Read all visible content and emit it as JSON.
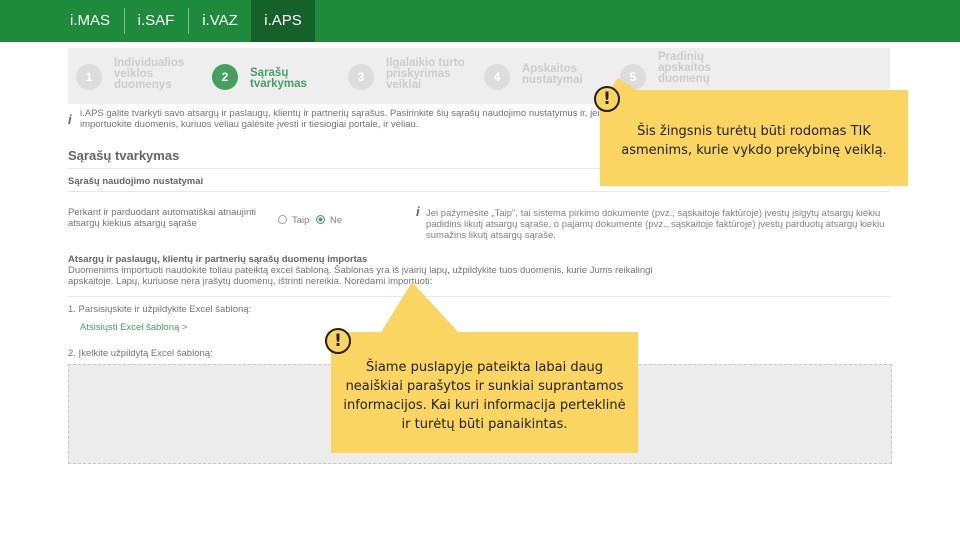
{
  "nav": {
    "tabs": [
      {
        "label": "i.MAS",
        "active": false
      },
      {
        "label": "i.SAF",
        "active": false
      },
      {
        "label": "i.VAZ",
        "active": false
      },
      {
        "label": "i.APS",
        "active": true
      }
    ]
  },
  "stepper": {
    "steps": [
      {
        "num": "1",
        "label": "Individualios veiklos duomenys",
        "active": false
      },
      {
        "num": "2",
        "label": "Sąrašų tvarkymas",
        "active": true
      },
      {
        "num": "3",
        "label": "Ilgalaikio turto priskyrimas veiklai",
        "active": false
      },
      {
        "num": "4",
        "label": "Apskaitos nustatymai",
        "active": false
      },
      {
        "num": "5",
        "label": "Pradinių apskaitos duomenų",
        "active": false
      }
    ]
  },
  "info_top": "i.APS galite tvarkyti savo atsargų ir paslaugų, klientų ir partnerių sąrašus. Pasirinkite šių sąrašų naudojimo nustatymus ir, jei norite, importuokite duomenis, kuriuos vėliau galėsite įvesti ir tiesiogiai portale, ir vėliau.",
  "section_title": "Sąrašų tvarkymas",
  "subsection_title": "Sąrašų naudojimo nustatymai",
  "auto_update_label": "Perkant ir parduodant automatiškai atnaujinti atsargų kiekius atsargų sąraše",
  "radio": {
    "yes": "Taip",
    "no": "Ne",
    "selected": "Ne"
  },
  "info_right": "Jei pažymėsite „Taip\", tai sistema pirkimo dokumente (pvz., sąskaitoje faktūroje) įvestų įsigytų atsargų kiekiu padidins likutį atsargų sąraše, o pajamų dokumente (pvz., sąskaitoje faktūroje) įvestų parduotų atsargų kiekiu sumažins likutį atsargų sąraše.",
  "import": {
    "heading": "Atsargų ir paslaugų, klientų ir partnerių sąrašų duomenų importas",
    "text": "Duomenims importuoti naudokite toliau pateiktą excel šabloną. Šablonas yra iš įvairių lapų, užpildykite tuos duomenis, kurie Jums reikalingi apskaitoje. Lapų, kuriuose nėra įrašytų duomenų, ištrinti nereikia. Norėdami importuoti:",
    "step1": "1. Parsisiųskite ir užpildykite Excel šabloną:",
    "download_link": "Atsisiųsti Excel šabloną  >",
    "step2": "2. Įkelkite užpildytą Excel šabloną:"
  },
  "callouts": {
    "warn_symbol": "!",
    "note1": "Šis žingsnis turėtų būti rodomas TIK asmenims, kurie vykdo prekybinę veiklą.",
    "note2": "Šiame puslapyje pateikta labai daug neaiškiai parašytos ir sunkiai suprantamos informacijos. Kai kuri informacija perteklinė ir turėtų būti panaikintas."
  },
  "colors": {
    "brand_green": "#1d8a3c",
    "callout_yellow": "#fbd562"
  }
}
